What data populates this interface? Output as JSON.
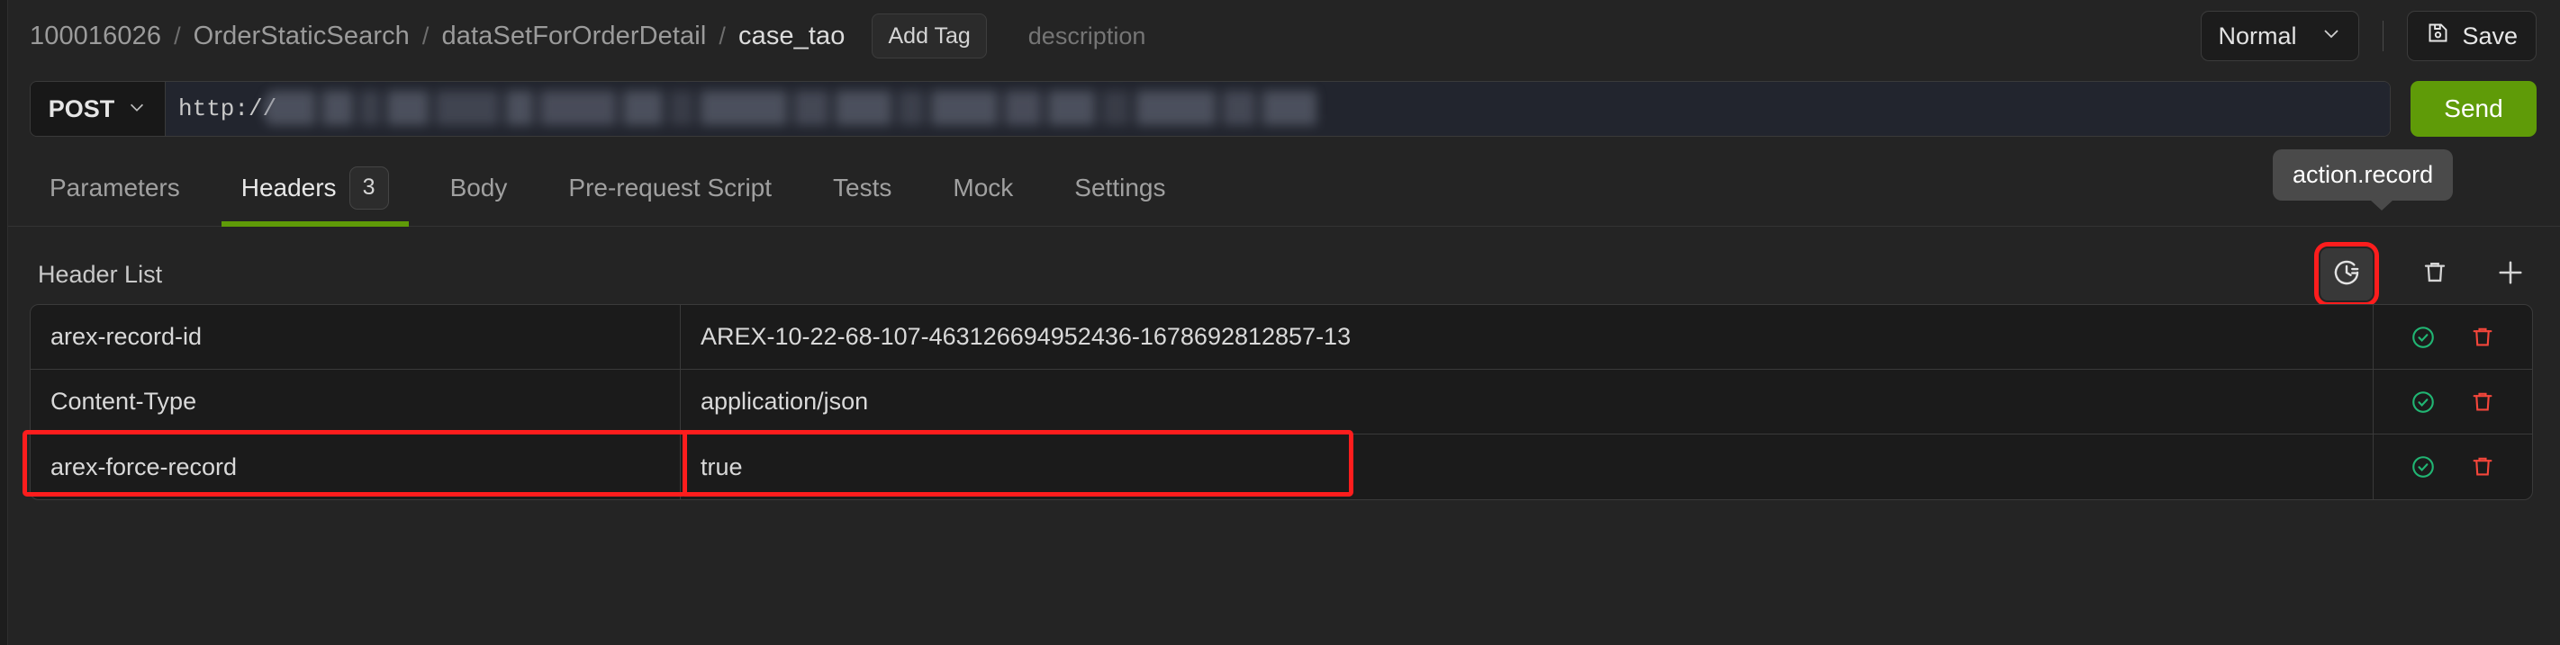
{
  "breadcrumb": {
    "items": [
      "100016026",
      "OrderStaticSearch",
      "dataSetForOrderDetail",
      "case_tao"
    ],
    "separator": "/"
  },
  "header": {
    "add_tag_label": "Add Tag",
    "description_placeholder": "description",
    "mode_select_value": "Normal",
    "chevron_icon": "chevron-down-icon",
    "save_label": "Save",
    "save_icon": "floppy-disk-icon"
  },
  "request": {
    "method": "POST",
    "method_chevron_icon": "chevron-down-icon",
    "url_visible_prefix": "http://",
    "url_redacted": true,
    "send_label": "Send",
    "send_color": "#5f9b08"
  },
  "tabs": [
    {
      "label": "Parameters",
      "badge": null,
      "active": false
    },
    {
      "label": "Headers",
      "badge": "3",
      "active": true
    },
    {
      "label": "Body",
      "badge": null,
      "active": false
    },
    {
      "label": "Pre-request Script",
      "badge": null,
      "active": false
    },
    {
      "label": "Tests",
      "badge": null,
      "active": false
    },
    {
      "label": "Mock",
      "badge": null,
      "active": false
    },
    {
      "label": "Settings",
      "badge": null,
      "active": false
    }
  ],
  "tooltip": {
    "text": "action.record"
  },
  "header_list": {
    "title": "Header List",
    "actions": [
      {
        "name": "record-history-icon",
        "selected": true
      },
      {
        "name": "trash-icon",
        "selected": false
      },
      {
        "name": "plus-icon",
        "selected": false
      }
    ],
    "rows": [
      {
        "key": "arex-record-id",
        "value": "AREX-10-22-68-107-463126694952436-1678692812857-13",
        "enabled_icon": "check-circle-icon",
        "delete_icon": "trash-icon",
        "highlighted": false
      },
      {
        "key": "Content-Type",
        "value": "application/json",
        "enabled_icon": "check-circle-icon",
        "delete_icon": "trash-icon",
        "highlighted": false
      },
      {
        "key": "arex-force-record",
        "value": "true",
        "enabled_icon": "check-circle-icon",
        "delete_icon": "trash-icon",
        "highlighted": true
      }
    ]
  },
  "colors": {
    "background": "#242424",
    "accent_green": "#5f9b08",
    "highlight_red": "#fd1d1d",
    "check_green": "#21b573",
    "delete_red": "#f4463b"
  }
}
